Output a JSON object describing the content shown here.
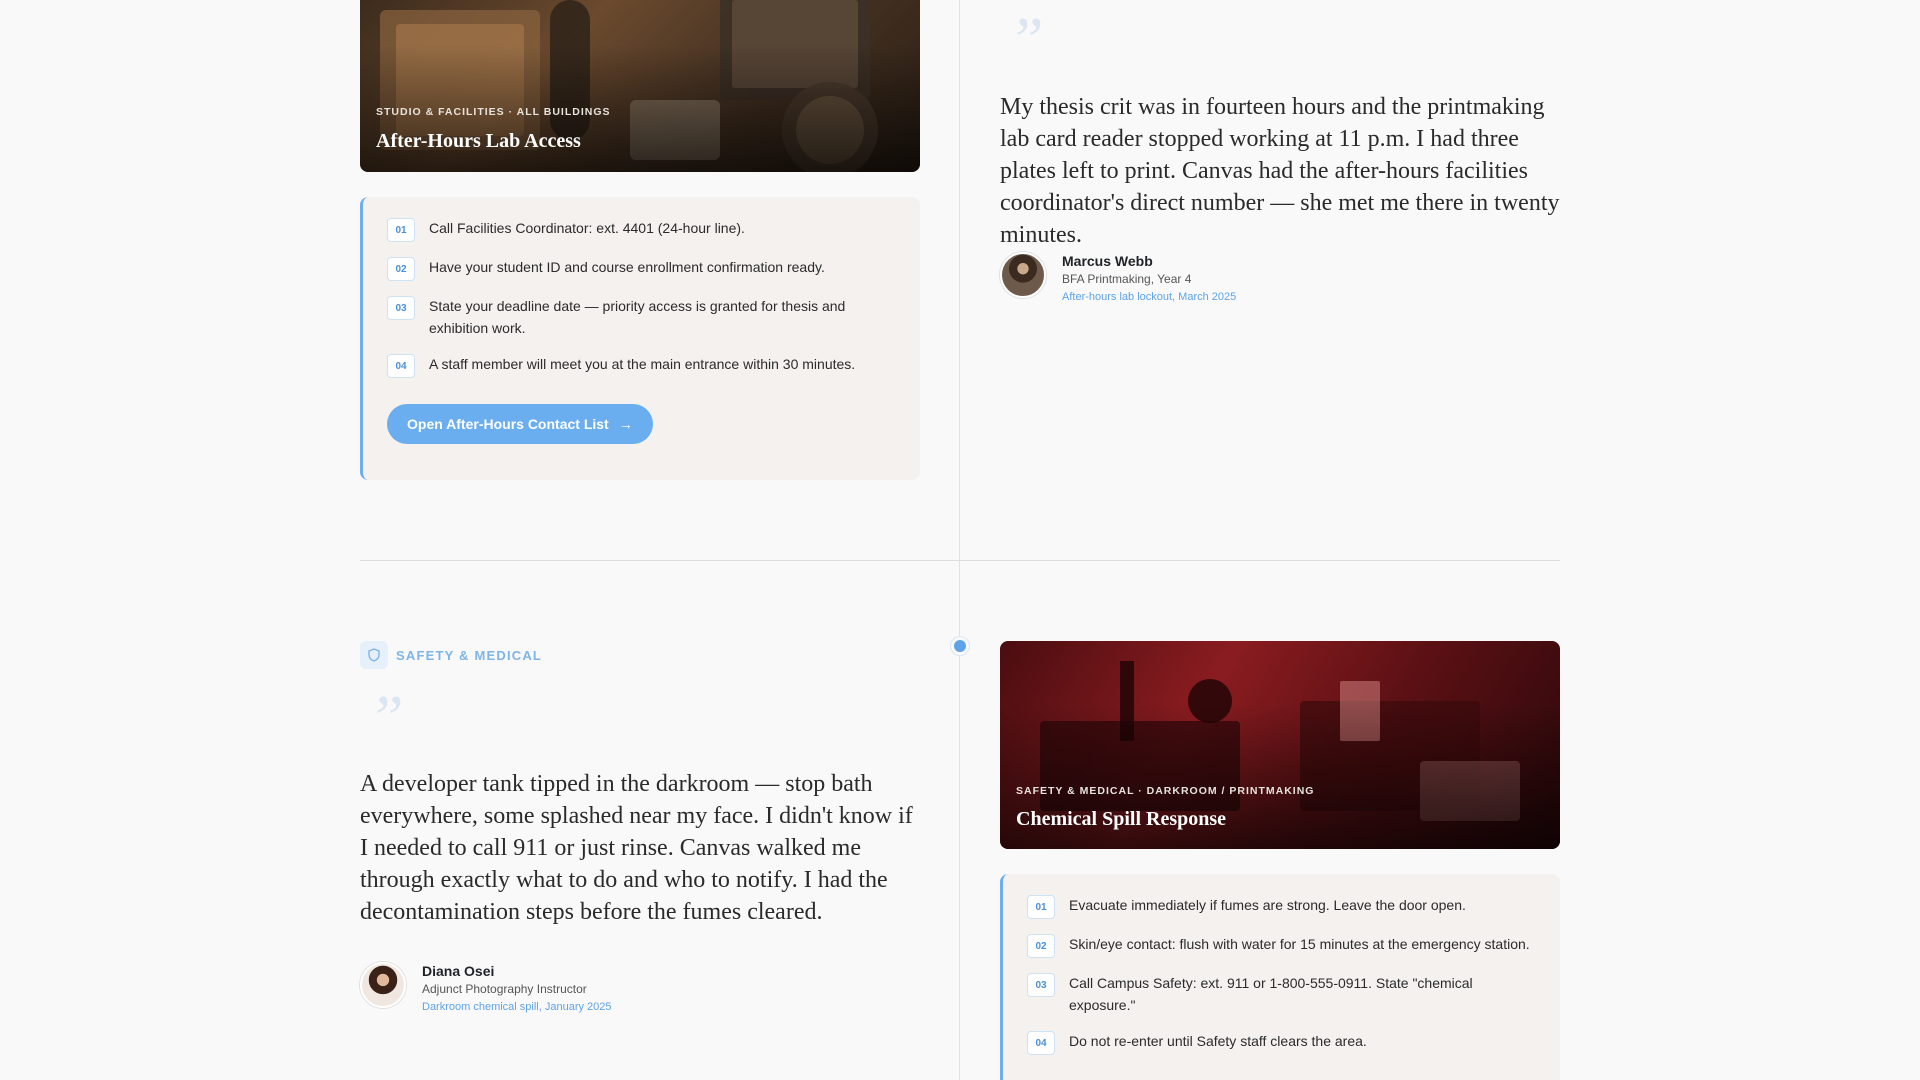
{
  "story_1": {
    "hero": {
      "kicker": "STUDIO & FACILITIES · ALL BUILDINGS",
      "title": "After-Hours Lab Access"
    },
    "steps": [
      {
        "num": "01",
        "text": "Call Facilities Coordinator: ext. 4401 (24-hour line)."
      },
      {
        "num": "02",
        "text": "Have your student ID and course enrollment confirmation ready."
      },
      {
        "num": "03",
        "text": "State your deadline date — priority access is granted for thesis and exhibition work."
      },
      {
        "num": "04",
        "text": "A staff member will meet you at the main entrance within 30 minutes."
      }
    ],
    "cta_label": "Open After-Hours Contact List",
    "quote": "My thesis crit was in fourteen hours and the printmaking lab card reader stopped working at 11 p.m. I had three plates left to print. Canvas had the after-hours facilities coordinator's direct number — she met me there in twenty minutes.",
    "author": {
      "name": "Marcus Webb",
      "role": "BFA Printmaking, Year 4",
      "meta": "After-hours lab lockout, March 2025"
    }
  },
  "story_2": {
    "category": {
      "icon": "shield-icon",
      "label": "SAFETY & MEDICAL"
    },
    "quote": "A developer tank tipped in the darkroom — stop bath everywhere, some splashed near my face. I didn't know if I needed to call 911 or just rinse. Canvas walked me through exactly what to do and who to notify. I had the decontamination steps before the fumes cleared.",
    "author": {
      "name": "Diana Osei",
      "role": "Adjunct Photography Instructor",
      "meta": "Darkroom chemical spill, January 2025"
    },
    "hero": {
      "kicker": "SAFETY & MEDICAL · DARKROOM / PRINTMAKING",
      "title": "Chemical Spill Response"
    },
    "steps": [
      {
        "num": "01",
        "text": "Evacuate immediately if fumes are strong. Leave the door open."
      },
      {
        "num": "02",
        "text": "Skin/eye contact: flush with water for 15 minutes at the emergency station."
      },
      {
        "num": "03",
        "text": "Call Campus Safety: ext. 911 or 1-800-555-0911. State \"chemical exposure.\""
      },
      {
        "num": "04",
        "text": "Do not re-enter until Safety staff clears the area."
      }
    ]
  },
  "quote_glyph": "”",
  "cta_arrow": "→",
  "colors": {
    "accent": "#6aaef0",
    "panel": "#f4f1ee",
    "background": "#f9f9f9"
  }
}
